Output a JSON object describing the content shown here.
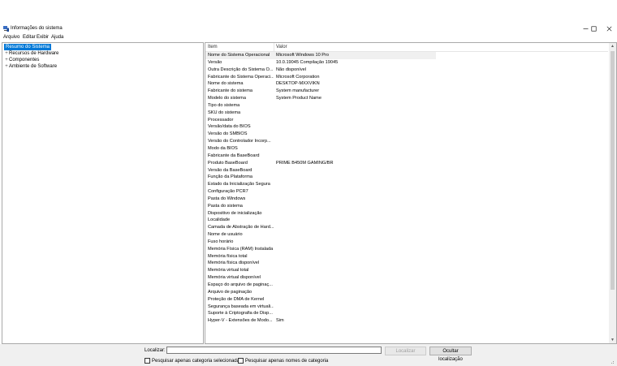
{
  "window": {
    "title": "Informações do sistema"
  },
  "menu": [
    "Arquivo",
    "Editar",
    "Exibir",
    "Ajuda"
  ],
  "tree": [
    {
      "label": "Resumo do Sistema",
      "selected": true,
      "expander": ""
    },
    {
      "label": "Recursos de Hardware",
      "selected": false,
      "expander": "+"
    },
    {
      "label": "Componentes",
      "selected": false,
      "expander": "+"
    },
    {
      "label": "Ambiente de Software",
      "selected": false,
      "expander": "+"
    }
  ],
  "list": {
    "columns": {
      "item": "Item",
      "value": "Valor"
    },
    "rows": [
      {
        "item": "Nome do Sistema Operacional",
        "value": "Microsoft Windows 10 Pro"
      },
      {
        "item": "Versão",
        "value": "10.0.19045 Compilação 19045"
      },
      {
        "item": "Outra Descrição do Sistema O...",
        "value": "Não disponível"
      },
      {
        "item": "Fabricante do Sistema Operaci...",
        "value": "Microsoft Corporation"
      },
      {
        "item": "Nome do sistema",
        "value": "DESKTOP-MXXVIKN"
      },
      {
        "item": "Fabricante do sistema",
        "value": "System manufacturer"
      },
      {
        "item": "Modelo do sistema",
        "value": "System Product Name"
      },
      {
        "item": "Tipo do sistema",
        "value": ""
      },
      {
        "item": "SKU do sistema",
        "value": ""
      },
      {
        "item": "Processador",
        "value": ""
      },
      {
        "item": "Versão/data do BIOS",
        "value": ""
      },
      {
        "item": "Versão do SMBIOS",
        "value": ""
      },
      {
        "item": "Versão do Controlador Incorp...",
        "value": ""
      },
      {
        "item": "Modo da BIOS",
        "value": ""
      },
      {
        "item": "Fabricante da BaseBoard",
        "value": ""
      },
      {
        "item": "Produto BaseBoard",
        "value": "PRIME B450M GAMING/BR"
      },
      {
        "item": "Versão da BaseBoard",
        "value": ""
      },
      {
        "item": "Função da Plataforma",
        "value": ""
      },
      {
        "item": "Estado da Inicialização Segura",
        "value": ""
      },
      {
        "item": "Configuração PCR7",
        "value": ""
      },
      {
        "item": "Pasta do Windows",
        "value": ""
      },
      {
        "item": "Pasta do sistema",
        "value": ""
      },
      {
        "item": "Dispositivo de inicialização",
        "value": ""
      },
      {
        "item": "Localidade",
        "value": ""
      },
      {
        "item": "Camada de Abstração de Hard...",
        "value": ""
      },
      {
        "item": "Nome de usuário",
        "value": ""
      },
      {
        "item": "Fuso horário",
        "value": ""
      },
      {
        "item": "Memória Física (RAM) Instalada",
        "value": ""
      },
      {
        "item": "Memória física total",
        "value": ""
      },
      {
        "item": "Memória física disponível",
        "value": ""
      },
      {
        "item": "Memória virtual total",
        "value": ""
      },
      {
        "item": "Memória virtual disponível",
        "value": ""
      },
      {
        "item": "Espaço do arquivo de paginaç...",
        "value": ""
      },
      {
        "item": "Arquivo de paginação",
        "value": ""
      },
      {
        "item": "Proteção de DMA de Kernel",
        "value": ""
      },
      {
        "item": "Segurança baseada em virtuali...",
        "value": ""
      },
      {
        "item": "Suporte à Criptografia de Disp...",
        "value": ""
      },
      {
        "item": "Hyper-V - Extensões de Modo...",
        "value": "Sim"
      }
    ]
  },
  "find": {
    "label": "Localizar:",
    "value": "",
    "find_button": "Localizar",
    "hide_button": "Ocultar localização",
    "checkbox_selected_category": "Pesquisar apenas categoria selecionada",
    "checkbox_category_names": "Pesquisar apenas nomes de categoria"
  }
}
